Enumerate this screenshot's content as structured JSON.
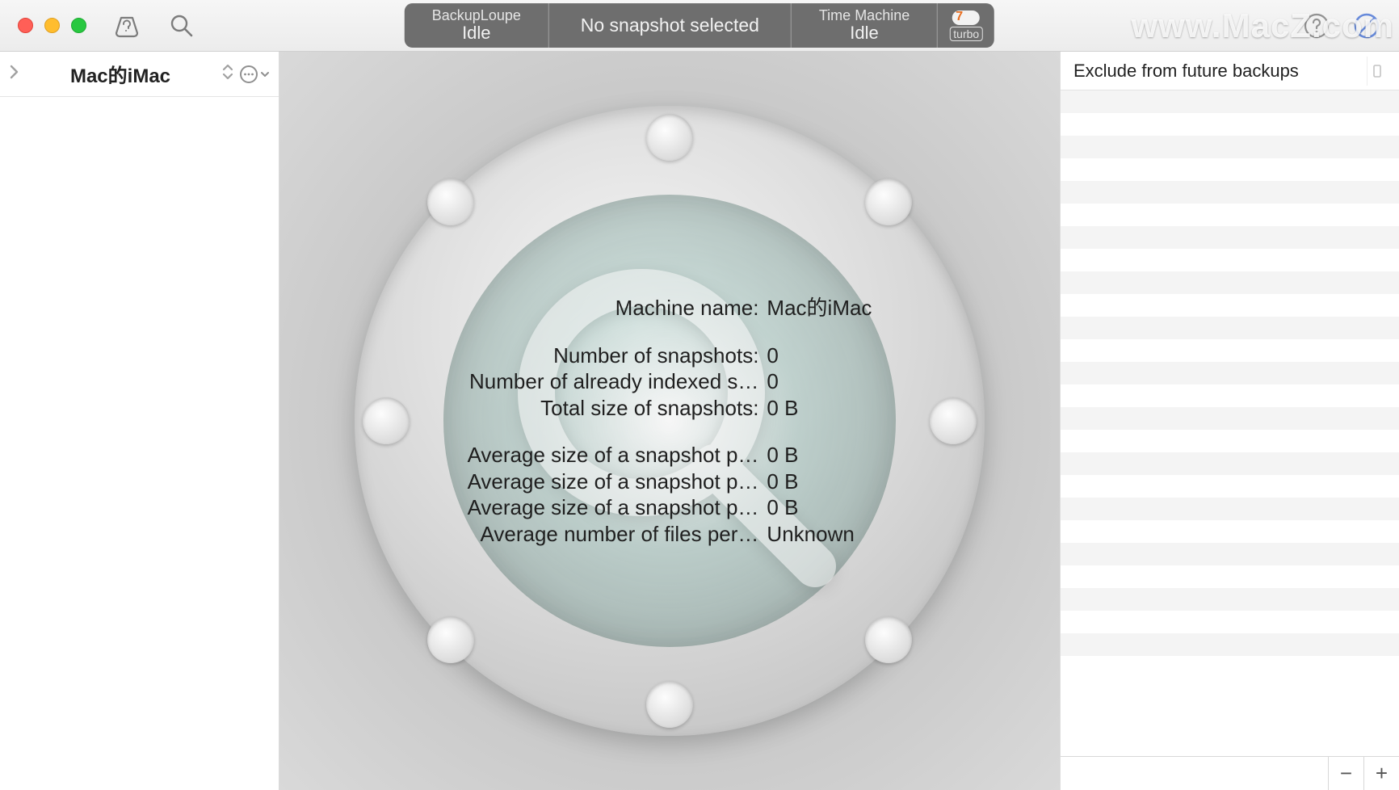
{
  "toolbar": {
    "app_name": "BackupLoupe",
    "app_state": "Idle",
    "snapshot_status": "No snapshot selected",
    "tm_name": "Time Machine",
    "tm_state": "Idle",
    "turbo_label": "turbo"
  },
  "sidebar": {
    "selected_machine": "Mac的iMac"
  },
  "info": {
    "rows": [
      {
        "label": "Machine name:",
        "value": "Mac的iMac"
      },
      null,
      {
        "label": "Number of snapshots:",
        "value": "0"
      },
      {
        "label": "Number of already indexed s…",
        "value": "0"
      },
      {
        "label": "Total size of snapshots:",
        "value": "0 B"
      },
      null,
      {
        "label": "Average size of a snapshot p…",
        "value": "0 B"
      },
      {
        "label": "Average size of a snapshot p…",
        "value": "0 B"
      },
      {
        "label": "Average size of a snapshot p…",
        "value": "0 B"
      },
      {
        "label": "Average number of files per…",
        "value": "Unknown"
      }
    ]
  },
  "right": {
    "title": "Exclude from future backups",
    "remove_label": "−",
    "add_label": "+"
  },
  "watermark": "www.MacZ.com"
}
